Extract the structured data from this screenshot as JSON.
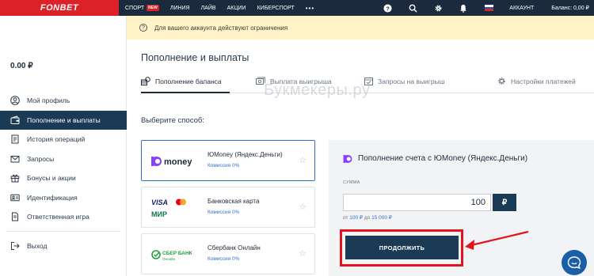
{
  "topbar": {
    "logo": "FONBET",
    "nav": [
      {
        "label": "СПОРТ",
        "badge": "NEW"
      },
      {
        "label": "ЛИНИЯ"
      },
      {
        "label": "ЛАЙВ"
      },
      {
        "label": "АКЦИИ"
      },
      {
        "label": "КИБЕРСПОРТ"
      }
    ],
    "more": "•••",
    "account_label": "АККАУНТ",
    "balance_label": "Баланс: 0,00 ₽"
  },
  "sidebar": {
    "balance": "0.00 ₽",
    "items": [
      {
        "label": "Мой профиль",
        "icon": "user-icon",
        "active": false
      },
      {
        "label": "Пополнение и выплаты",
        "icon": "wallet-icon",
        "active": true
      },
      {
        "label": "История операций",
        "icon": "history-icon",
        "active": false
      },
      {
        "label": "Запросы",
        "icon": "mail-icon",
        "active": false
      },
      {
        "label": "Бонусы и акции",
        "icon": "gift-icon",
        "active": false
      },
      {
        "label": "Идентификация",
        "icon": "id-card-icon",
        "active": false
      },
      {
        "label": "Ответственная игра",
        "icon": "document-icon",
        "active": false
      }
    ],
    "logout": "Выход"
  },
  "alert": {
    "text": "Для вашего аккаунта действуют ограничения"
  },
  "main": {
    "title": "Пополнение и выплаты",
    "tabs": [
      {
        "label": "Пополнение баланса",
        "active": true
      },
      {
        "label": "Выплата выигрыша",
        "active": false
      },
      {
        "label": "Запросы на выигрыш",
        "active": false
      },
      {
        "label": "Настройки платежей",
        "active": false
      }
    ],
    "watermark": "Букмекеры.ру",
    "choose_label": "Выберите способ:",
    "methods": [
      {
        "logo_text": "money",
        "name": "ЮMoney (Яндекс.Деньги)",
        "fee": "Комиссия 0%",
        "selected": true
      },
      {
        "logo_text": "VISA",
        "logo_text2": "МИР",
        "name": "Банковская карта",
        "fee": "Комиссия 0%",
        "selected": false
      },
      {
        "logo_text": "СБЕР БАНК",
        "logo_sub": "Онлайн",
        "name": "Сбербанк Онлайн",
        "fee": "Комиссия 0%",
        "selected": false
      }
    ],
    "panel": {
      "title": "Пополнение счета с ЮMoney (Яндекс.Деньги)",
      "sum_label": "СУММА",
      "amount": "100",
      "currency": "₽",
      "range_prefix": "от",
      "range_min": "100 ₽",
      "range_mid": "до",
      "range_max": "15 000 ₽",
      "button": "ПРОДОЛЖИТЬ"
    }
  },
  "colors": {
    "brand_red": "#dc2128",
    "navy": "#1b3a55",
    "link_blue": "#2e6fd0",
    "alert_bg": "#fff4c8"
  }
}
